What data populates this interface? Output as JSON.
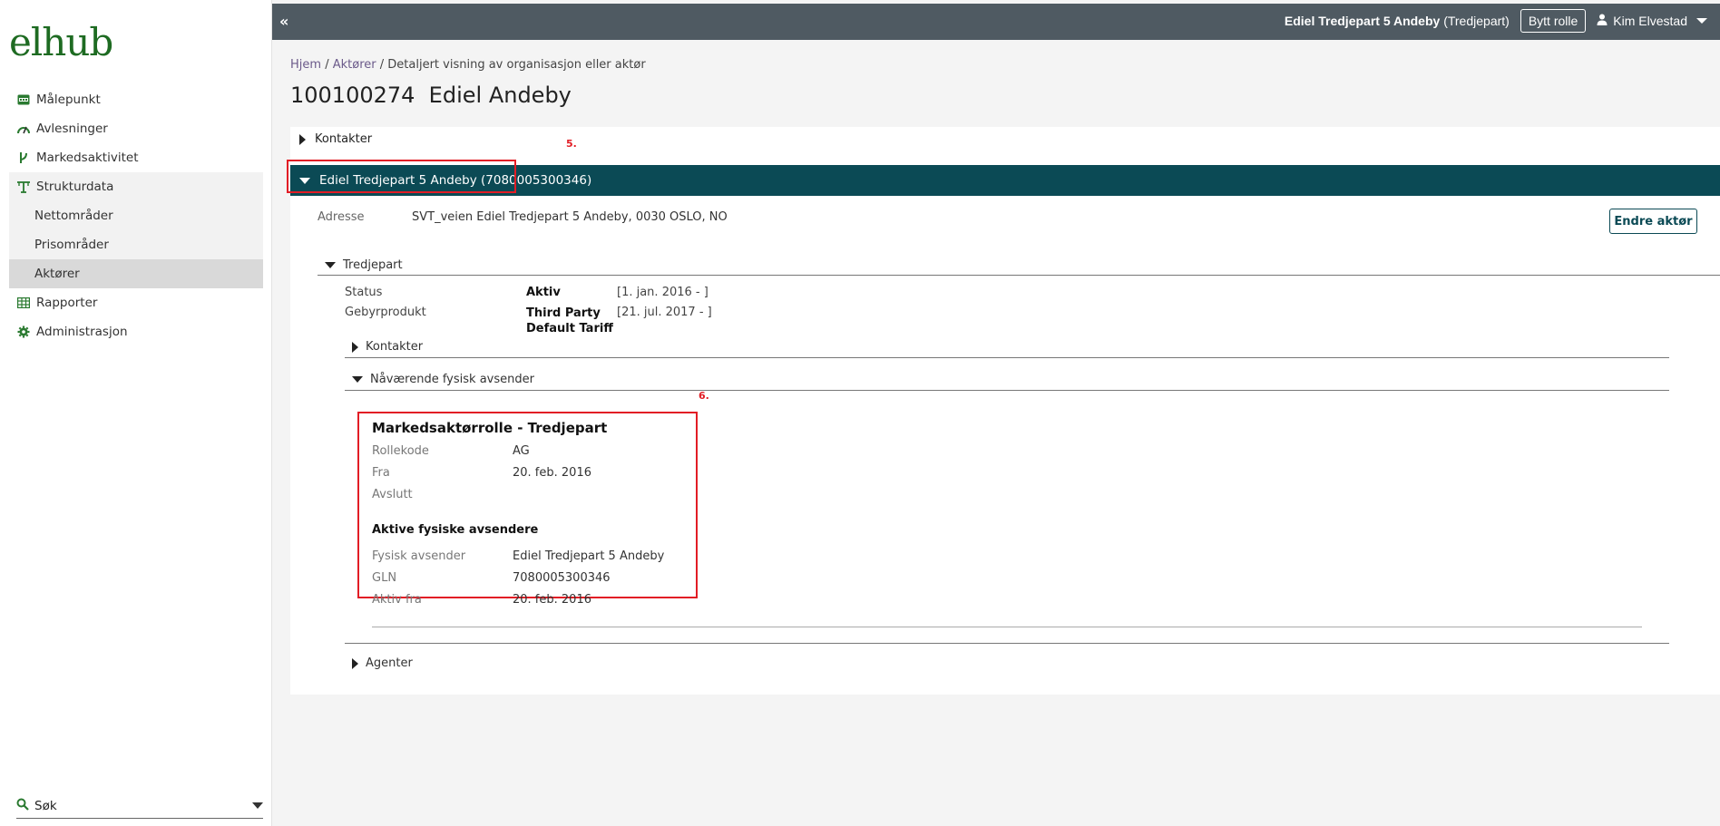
{
  "brand": {
    "logo": "elhub"
  },
  "sidebar": {
    "items": [
      {
        "label": "Målepunkt",
        "icon": "meter-icon"
      },
      {
        "label": "Avlesninger",
        "icon": "gauge-icon"
      },
      {
        "label": "Markedsaktivitet",
        "icon": "branch-icon"
      },
      {
        "label": "Strukturdata",
        "icon": "structure-icon"
      },
      {
        "label": "Nettområder"
      },
      {
        "label": "Prisområder"
      },
      {
        "label": "Aktører",
        "active": true
      },
      {
        "label": "Rapporter",
        "icon": "table-icon"
      },
      {
        "label": "Administrasjon",
        "icon": "gear-icon"
      }
    ],
    "search_label": "Søk"
  },
  "topbar": {
    "collapse": "«",
    "actor_name": "Ediel Tredjepart 5 Andeby",
    "actor_role": "(Tredjepart)",
    "switch_role": "Bytt rolle",
    "user": "Kim Elvestad"
  },
  "breadcrumb": {
    "home": "Hjem",
    "sep": "/",
    "actors": "Aktører",
    "current": "Detaljert visning av organisasjon eller aktør"
  },
  "page": {
    "title": "100100274  Ediel Andeby"
  },
  "panel": {
    "kontakter": "Kontakter",
    "actor_bar": "Ediel Tredjepart 5 Andeby (7080005300346)",
    "marker5": "5.",
    "address_label": "Adresse",
    "address_value": "SVT_veien Ediel Tredjepart 5 Andeby, 0030 OSLO, NO",
    "edit_button": "Endre aktør",
    "tredjepart": "Tredjepart",
    "status_label": "Status",
    "status_value": "Aktiv",
    "status_date": "[1. jan. 2016 - ]",
    "fee_label": "Gebyrprodukt",
    "fee_value_1": "Third Party",
    "fee_value_2": "Default Tariff",
    "fee_date": "[21. jul. 2017 - ]",
    "sub_kontakter": "Kontakter",
    "current_sender": "Nåværende fysisk avsender",
    "marker6": "6.",
    "agenter": "Agenter"
  },
  "card": {
    "title": "Markedsaktørrolle - Tredjepart",
    "role_code_label": "Rollekode",
    "role_code_value": "AG",
    "from_label": "Fra",
    "from_value": "20. feb. 2016",
    "end_label": "Avslutt",
    "active_senders": "Aktive fysiske avsendere",
    "sender_label": "Fysisk avsender",
    "sender_value": "Ediel Tredjepart 5 Andeby",
    "gln_label": "GLN",
    "gln_value": "7080005300346",
    "active_from_label": "Aktiv fra",
    "active_from_value": "20. feb. 2016"
  },
  "colors": {
    "brand_green": "#1e6b22",
    "topbar": "#4f5a62",
    "actor_bar": "#0b4a55",
    "highlight": "#e21d25"
  }
}
